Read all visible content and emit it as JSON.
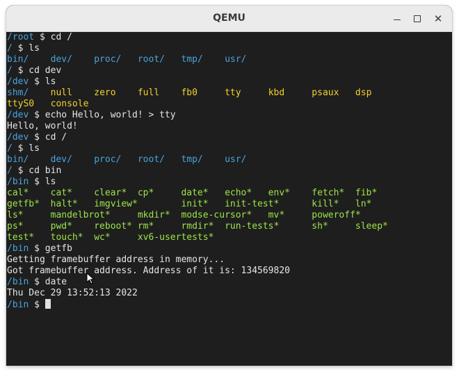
{
  "window": {
    "title": "QEMU"
  },
  "terminal": {
    "lines": [
      [
        {
          "t": "/root",
          "c": "c-blue"
        },
        {
          "t": " $ cd /",
          "c": "c-white"
        }
      ],
      [
        {
          "t": "/",
          "c": "c-blue"
        },
        {
          "t": " $ ls",
          "c": "c-white"
        }
      ],
      [
        {
          "t": "bin/    dev/    proc/   root/   tmp/    usr/",
          "c": "c-blue"
        }
      ],
      [
        {
          "t": "/",
          "c": "c-blue"
        },
        {
          "t": " $ cd dev",
          "c": "c-white"
        }
      ],
      [
        {
          "t": "/dev",
          "c": "c-blue"
        },
        {
          "t": " $ ls",
          "c": "c-white"
        }
      ],
      [
        {
          "t": "shm/    ",
          "c": "c-blue"
        },
        {
          "t": "null    zero    full    fb0     tty     kbd     psaux   dsp",
          "c": "c-yellow"
        }
      ],
      [
        {
          "t": "ttyS0   console",
          "c": "c-yellow"
        }
      ],
      [
        {
          "t": "/dev",
          "c": "c-blue"
        },
        {
          "t": " $ echo Hello, world! > tty",
          "c": "c-white"
        }
      ],
      [
        {
          "t": "Hello, world!",
          "c": "c-white"
        }
      ],
      [
        {
          "t": "/dev",
          "c": "c-blue"
        },
        {
          "t": " $ cd /",
          "c": "c-white"
        }
      ],
      [
        {
          "t": "/",
          "c": "c-blue"
        },
        {
          "t": " $ ls",
          "c": "c-white"
        }
      ],
      [
        {
          "t": "bin/    dev/    proc/   root/   tmp/    usr/",
          "c": "c-blue"
        }
      ],
      [
        {
          "t": "/",
          "c": "c-blue"
        },
        {
          "t": " $ cd bin",
          "c": "c-white"
        }
      ],
      [
        {
          "t": "/bin",
          "c": "c-blue"
        },
        {
          "t": " $ ls",
          "c": "c-white"
        }
      ],
      [
        {
          "t": "cal*    cat*    clear*  cp*     date*   echo*   env*    fetch*  fib*",
          "c": "c-green"
        }
      ],
      [
        {
          "t": "getfb*  halt*   imgview*        init*   init-test*      kill*   ln*",
          "c": "c-green"
        }
      ],
      [
        {
          "t": "ls*     mandelbrot*     mkdir*  modse-cursor*   mv*     poweroff*",
          "c": "c-green"
        }
      ],
      [
        {
          "t": "ps*     pwd*    reboot* rm*     rmdir*  run-tests*      sh*     sleep*",
          "c": "c-green"
        }
      ],
      [
        {
          "t": "test*   touch*  wc*     xv6-usertests*",
          "c": "c-green"
        }
      ],
      [
        {
          "t": "/bin",
          "c": "c-blue"
        },
        {
          "t": " $ getfb",
          "c": "c-white"
        }
      ],
      [
        {
          "t": "Getting framebuffer address in memory...",
          "c": "c-white"
        }
      ],
      [
        {
          "t": "Got framebuffer address. Address of it is: 134569820",
          "c": "c-white"
        }
      ],
      [
        {
          "t": "/bin",
          "c": "c-blue"
        },
        {
          "t": " $ date",
          "c": "c-white"
        }
      ],
      [
        {
          "t": "Thu Dec 29 13:52:13 2022",
          "c": "c-white"
        }
      ],
      [
        {
          "t": "/bin",
          "c": "c-blue"
        },
        {
          "t": " $ ",
          "c": "c-white"
        }
      ]
    ]
  },
  "colors": {
    "prompt": "#4aa3df",
    "executable": "#9ee54a",
    "device": "#f2d12e",
    "text": "#e6e6e6",
    "background": "#1e1e1e"
  },
  "icons": {
    "minimize": "minimize-icon",
    "maximize": "maximize-icon",
    "close": "close-icon",
    "pointer": "mouse-pointer-icon"
  }
}
